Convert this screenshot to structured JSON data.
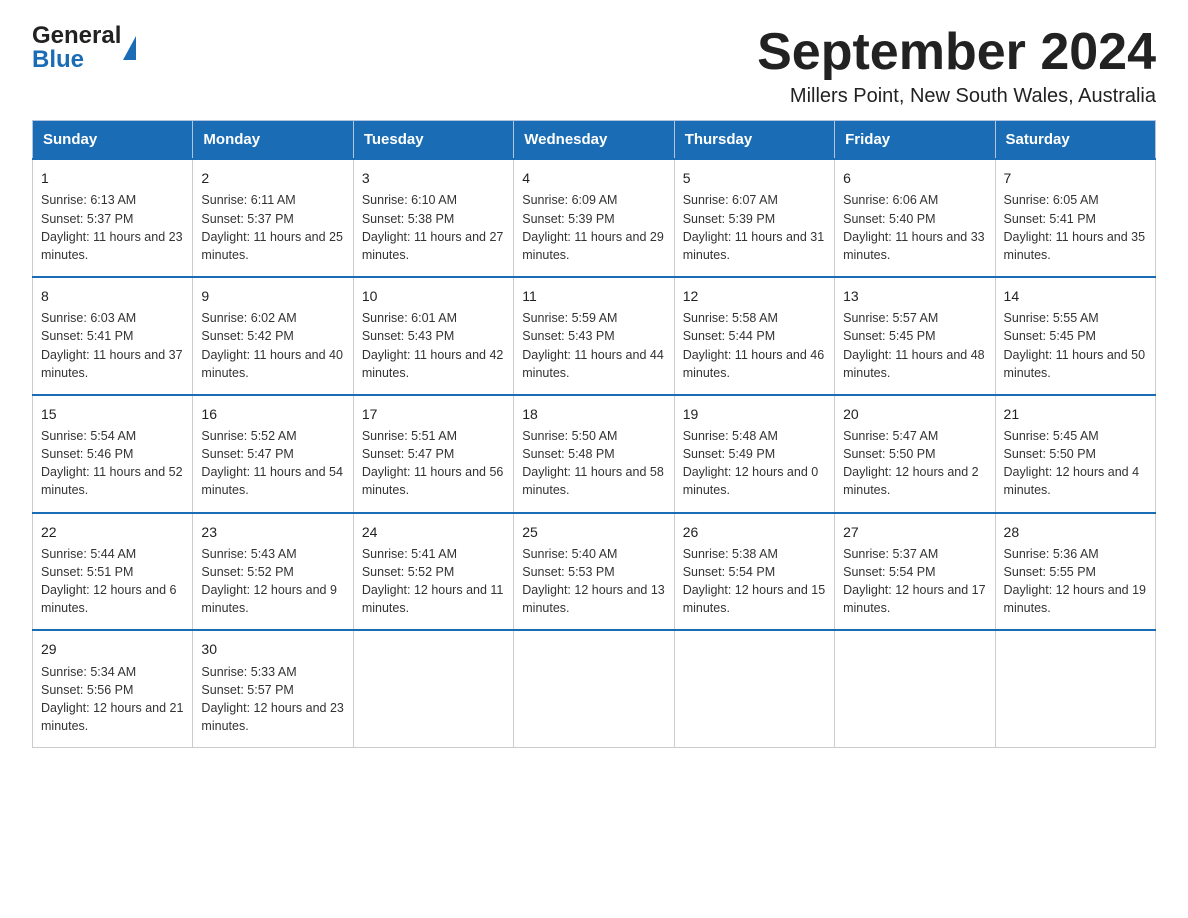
{
  "header": {
    "logo_general": "General",
    "logo_blue": "Blue",
    "month_title": "September 2024",
    "location": "Millers Point, New South Wales, Australia"
  },
  "weekdays": [
    "Sunday",
    "Monday",
    "Tuesday",
    "Wednesday",
    "Thursday",
    "Friday",
    "Saturday"
  ],
  "weeks": [
    [
      {
        "day": "1",
        "sunrise": "6:13 AM",
        "sunset": "5:37 PM",
        "daylight": "11 hours and 23 minutes."
      },
      {
        "day": "2",
        "sunrise": "6:11 AM",
        "sunset": "5:37 PM",
        "daylight": "11 hours and 25 minutes."
      },
      {
        "day": "3",
        "sunrise": "6:10 AM",
        "sunset": "5:38 PM",
        "daylight": "11 hours and 27 minutes."
      },
      {
        "day": "4",
        "sunrise": "6:09 AM",
        "sunset": "5:39 PM",
        "daylight": "11 hours and 29 minutes."
      },
      {
        "day": "5",
        "sunrise": "6:07 AM",
        "sunset": "5:39 PM",
        "daylight": "11 hours and 31 minutes."
      },
      {
        "day": "6",
        "sunrise": "6:06 AM",
        "sunset": "5:40 PM",
        "daylight": "11 hours and 33 minutes."
      },
      {
        "day": "7",
        "sunrise": "6:05 AM",
        "sunset": "5:41 PM",
        "daylight": "11 hours and 35 minutes."
      }
    ],
    [
      {
        "day": "8",
        "sunrise": "6:03 AM",
        "sunset": "5:41 PM",
        "daylight": "11 hours and 37 minutes."
      },
      {
        "day": "9",
        "sunrise": "6:02 AM",
        "sunset": "5:42 PM",
        "daylight": "11 hours and 40 minutes."
      },
      {
        "day": "10",
        "sunrise": "6:01 AM",
        "sunset": "5:43 PM",
        "daylight": "11 hours and 42 minutes."
      },
      {
        "day": "11",
        "sunrise": "5:59 AM",
        "sunset": "5:43 PM",
        "daylight": "11 hours and 44 minutes."
      },
      {
        "day": "12",
        "sunrise": "5:58 AM",
        "sunset": "5:44 PM",
        "daylight": "11 hours and 46 minutes."
      },
      {
        "day": "13",
        "sunrise": "5:57 AM",
        "sunset": "5:45 PM",
        "daylight": "11 hours and 48 minutes."
      },
      {
        "day": "14",
        "sunrise": "5:55 AM",
        "sunset": "5:45 PM",
        "daylight": "11 hours and 50 minutes."
      }
    ],
    [
      {
        "day": "15",
        "sunrise": "5:54 AM",
        "sunset": "5:46 PM",
        "daylight": "11 hours and 52 minutes."
      },
      {
        "day": "16",
        "sunrise": "5:52 AM",
        "sunset": "5:47 PM",
        "daylight": "11 hours and 54 minutes."
      },
      {
        "day": "17",
        "sunrise": "5:51 AM",
        "sunset": "5:47 PM",
        "daylight": "11 hours and 56 minutes."
      },
      {
        "day": "18",
        "sunrise": "5:50 AM",
        "sunset": "5:48 PM",
        "daylight": "11 hours and 58 minutes."
      },
      {
        "day": "19",
        "sunrise": "5:48 AM",
        "sunset": "5:49 PM",
        "daylight": "12 hours and 0 minutes."
      },
      {
        "day": "20",
        "sunrise": "5:47 AM",
        "sunset": "5:50 PM",
        "daylight": "12 hours and 2 minutes."
      },
      {
        "day": "21",
        "sunrise": "5:45 AM",
        "sunset": "5:50 PM",
        "daylight": "12 hours and 4 minutes."
      }
    ],
    [
      {
        "day": "22",
        "sunrise": "5:44 AM",
        "sunset": "5:51 PM",
        "daylight": "12 hours and 6 minutes."
      },
      {
        "day": "23",
        "sunrise": "5:43 AM",
        "sunset": "5:52 PM",
        "daylight": "12 hours and 9 minutes."
      },
      {
        "day": "24",
        "sunrise": "5:41 AM",
        "sunset": "5:52 PM",
        "daylight": "12 hours and 11 minutes."
      },
      {
        "day": "25",
        "sunrise": "5:40 AM",
        "sunset": "5:53 PM",
        "daylight": "12 hours and 13 minutes."
      },
      {
        "day": "26",
        "sunrise": "5:38 AM",
        "sunset": "5:54 PM",
        "daylight": "12 hours and 15 minutes."
      },
      {
        "day": "27",
        "sunrise": "5:37 AM",
        "sunset": "5:54 PM",
        "daylight": "12 hours and 17 minutes."
      },
      {
        "day": "28",
        "sunrise": "5:36 AM",
        "sunset": "5:55 PM",
        "daylight": "12 hours and 19 minutes."
      }
    ],
    [
      {
        "day": "29",
        "sunrise": "5:34 AM",
        "sunset": "5:56 PM",
        "daylight": "12 hours and 21 minutes."
      },
      {
        "day": "30",
        "sunrise": "5:33 AM",
        "sunset": "5:57 PM",
        "daylight": "12 hours and 23 minutes."
      },
      null,
      null,
      null,
      null,
      null
    ]
  ],
  "labels": {
    "sunrise": "Sunrise:",
    "sunset": "Sunset:",
    "daylight": "Daylight:"
  }
}
